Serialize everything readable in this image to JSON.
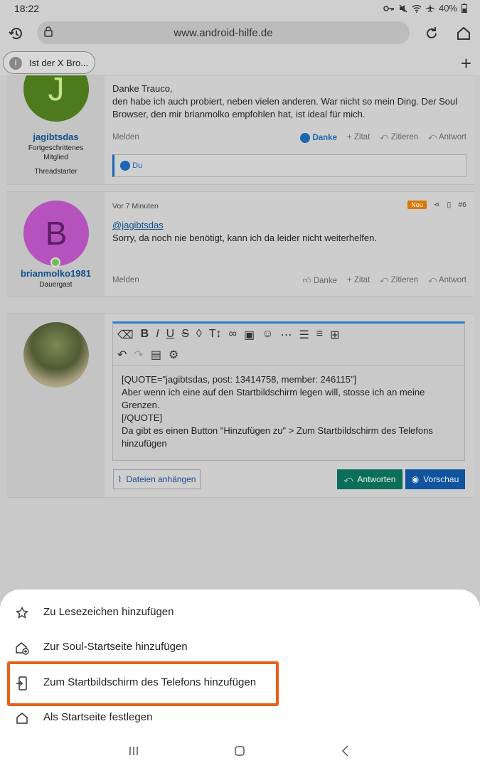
{
  "status": {
    "time": "18:22",
    "battery": "40%"
  },
  "browser": {
    "url": "www.android-hilfe.de",
    "tab_title": "Ist der X Bro...",
    "tab_favicon": "I"
  },
  "post1": {
    "username": "jagibtsdas",
    "avatar_letter": "J",
    "title_line1": "Fortgeschrittenes",
    "title_line2": "Mitglied",
    "role": "Threadstarter",
    "text_line1": "Danke Trauco,",
    "text_line2": "den habe ich auch probiert, neben vielen anderen. War nicht so mein Ding. Der Soul",
    "text_line3": "Browser, den mir brianmolko empfohlen hat, ist ideal für mich.",
    "reaction": "Du"
  },
  "post2": {
    "username": "brianmolko1981",
    "avatar_letter": "B",
    "title": "Dauergast",
    "time": "Vor 7 Minuten",
    "badge": "Neu",
    "number": "#6",
    "mention": "@jagibtsdas",
    "text": "Sorry, da noch nie benötigt, kann ich da leider nicht weiterhelfen."
  },
  "actions": {
    "report": "Melden",
    "thanks": "Danke",
    "quote": "Zitat",
    "cite": "Zitieren",
    "reply": "Antwort"
  },
  "editor": {
    "line1": "[QUOTE=\"jagibtsdas, post: 13414758, member: 246115\"]",
    "line2": "Aber wenn ich eine auf den Startbildschirm legen will, stosse ich an meine",
    "line3": "Grenzen.",
    "line4": "[/QUOTE]",
    "line5": "Da gibt es einen Button \"Hinzufügen zu\" > Zum Startbildschirm des Telefons",
    "line6": "hinzufügen",
    "attach": "Dateien anhängen",
    "submit": "Antworten",
    "preview": "Vorschau"
  },
  "sheet": {
    "items": [
      {
        "label": "Zu Lesezeichen hinzufügen",
        "icon": "star-icon"
      },
      {
        "label": "Zur Soul-Startseite hinzufügen",
        "icon": "home-add-icon"
      },
      {
        "label": "Zum Startbildschirm des Telefons hinzufügen",
        "icon": "phone-add-icon"
      },
      {
        "label": "Als Startseite festlegen",
        "icon": "home-icon"
      }
    ],
    "highlight_color": "#e8611a"
  },
  "colors": {
    "link": "#0f4f8a",
    "accent": "#1b67b2",
    "submit_bg": "#0b6e58",
    "preview_bg": "#11549e"
  }
}
